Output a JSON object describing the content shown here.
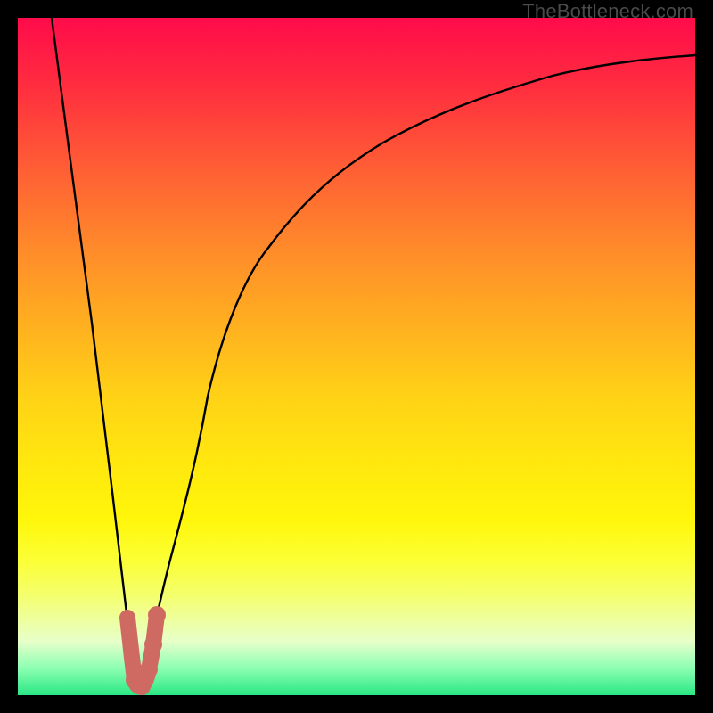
{
  "watermark": {
    "text": "TheBottleneck.com"
  },
  "colors": {
    "curve_stroke": "#000000",
    "marker_fill": "#cf6a63",
    "marker_stroke": "#cf6a63"
  },
  "chart_data": {
    "type": "line",
    "title": "",
    "xlabel": "",
    "ylabel": "",
    "xlim": [
      0,
      100
    ],
    "ylim": [
      0,
      100
    ],
    "grid": false,
    "series": [
      {
        "name": "left-branch",
        "x": [
          5,
          8,
          11,
          14,
          16,
          17.5
        ],
        "y": [
          100,
          78,
          55,
          30,
          12,
          2
        ]
      },
      {
        "name": "right-branch",
        "x": [
          18,
          20,
          22.5,
          25,
          28,
          32,
          37,
          43,
          50,
          58,
          67,
          78,
          90,
          100
        ],
        "y": [
          1,
          8,
          20,
          32,
          44,
          56,
          66,
          74,
          80,
          84.5,
          88,
          91,
          93,
          94.5
        ]
      }
    ],
    "markers": {
      "name": "bottom-hook",
      "points": [
        {
          "x": 16.2,
          "y": 11.5
        },
        {
          "x": 16.8,
          "y": 5.5
        },
        {
          "x": 17.3,
          "y": 2.2
        },
        {
          "x": 18.3,
          "y": 1.3
        },
        {
          "x": 19.4,
          "y": 3.8
        },
        {
          "x": 20.0,
          "y": 7.5
        },
        {
          "x": 20.5,
          "y": 11.8
        }
      ],
      "radius_px": 8,
      "endpoint_radius_px": 10
    }
  }
}
